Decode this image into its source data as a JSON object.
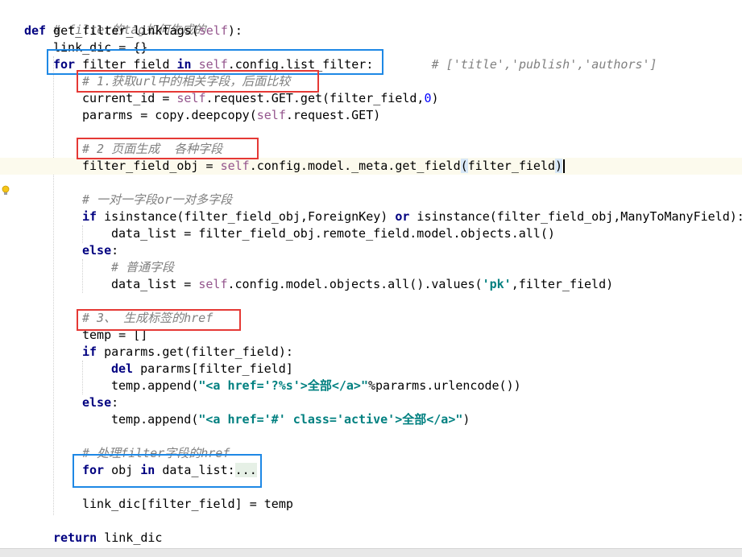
{
  "code": {
    "l1": {
      "comment": "# filter的tag如何生成的"
    },
    "l2": {
      "kw": "def",
      "name": " get_filter_linktags(",
      "self": "self",
      "end": "):"
    },
    "l3": {
      "text": "link_dic = {}"
    },
    "l4": {
      "kw_for": "for",
      "var": " filter_field ",
      "kw_in": "in",
      "sp": " ",
      "self": "self",
      "rest": ".config.list_filter:",
      "gap": "        ",
      "comment": "# ['title','publish','authors']"
    },
    "l5": {
      "comment": "# 1.获取url中的相关字段，后面比较"
    },
    "l6": {
      "pre": "current_id = ",
      "self": "self",
      "mid": ".request.GET.get(filter_field,",
      "num": "0",
      "end": ")"
    },
    "l7": {
      "pre": "pararms = copy.deepcopy(",
      "self": "self",
      "end": ".request.GET)"
    },
    "l8": {
      "comment": "# 2 页面生成  各种字段"
    },
    "l9": {
      "pre": "filter_field_obj = ",
      "self": "self",
      "mid": ".config.model._meta.get_field",
      "open": "(",
      "arg": "filter_field",
      "close": ")"
    },
    "l10": {
      "comment": "# 一对一字段or一对多字段"
    },
    "l11": {
      "kw_if": "if",
      "a": " isinstance(filter_field_obj,ForeignKey) ",
      "kw_or": "or",
      "b": " isinstance(filter_field_obj,ManyToManyField):"
    },
    "l12": {
      "text": "data_list = filter_field_obj.remote_field.model.objects.all()"
    },
    "l13": {
      "kw": "else",
      "end": ":"
    },
    "l14": {
      "comment": "# 普通字段"
    },
    "l15": {
      "pre": "data_list = ",
      "self": "self",
      "mid": ".config.model.objects.all().values(",
      "str": "'pk'",
      "end": ",filter_field)"
    },
    "l16": {
      "comment": "# 3、 生成标签的href"
    },
    "l17": {
      "text": "temp = []"
    },
    "l18": {
      "kw": "if",
      "rest": " pararms.get(filter_field):"
    },
    "l19": {
      "kw": "del",
      "rest": " pararms[filter_field]"
    },
    "l20": {
      "pre": "temp.append(",
      "str": "\"<a href='?%s'>全部</a>\"",
      "end": "%pararms.urlencode())"
    },
    "l21": {
      "kw": "else",
      "end": ":"
    },
    "l22": {
      "pre": "temp.append(",
      "str": "\"<a href='#' class='active'>全部</a>\"",
      "end": ")"
    },
    "l23": {
      "comment": "# 处理filter字段的href"
    },
    "l24": {
      "kw_for": "for",
      "var": " obj ",
      "kw_in": "in",
      "rest": " data_list:",
      "fold": "..."
    },
    "l25": {
      "text": "link_dic[filter_field] = temp"
    },
    "l26": {
      "kw": "return",
      "rest": " link_dic"
    }
  },
  "colors": {
    "keyword": "#000080",
    "self": "#94558d",
    "string": "#008080",
    "comment": "#808080",
    "number": "#0000ff",
    "annotation_red": "#e53935",
    "annotation_blue": "#1e88e5"
  },
  "icons": {
    "gutter": "lightbulb-icon"
  }
}
